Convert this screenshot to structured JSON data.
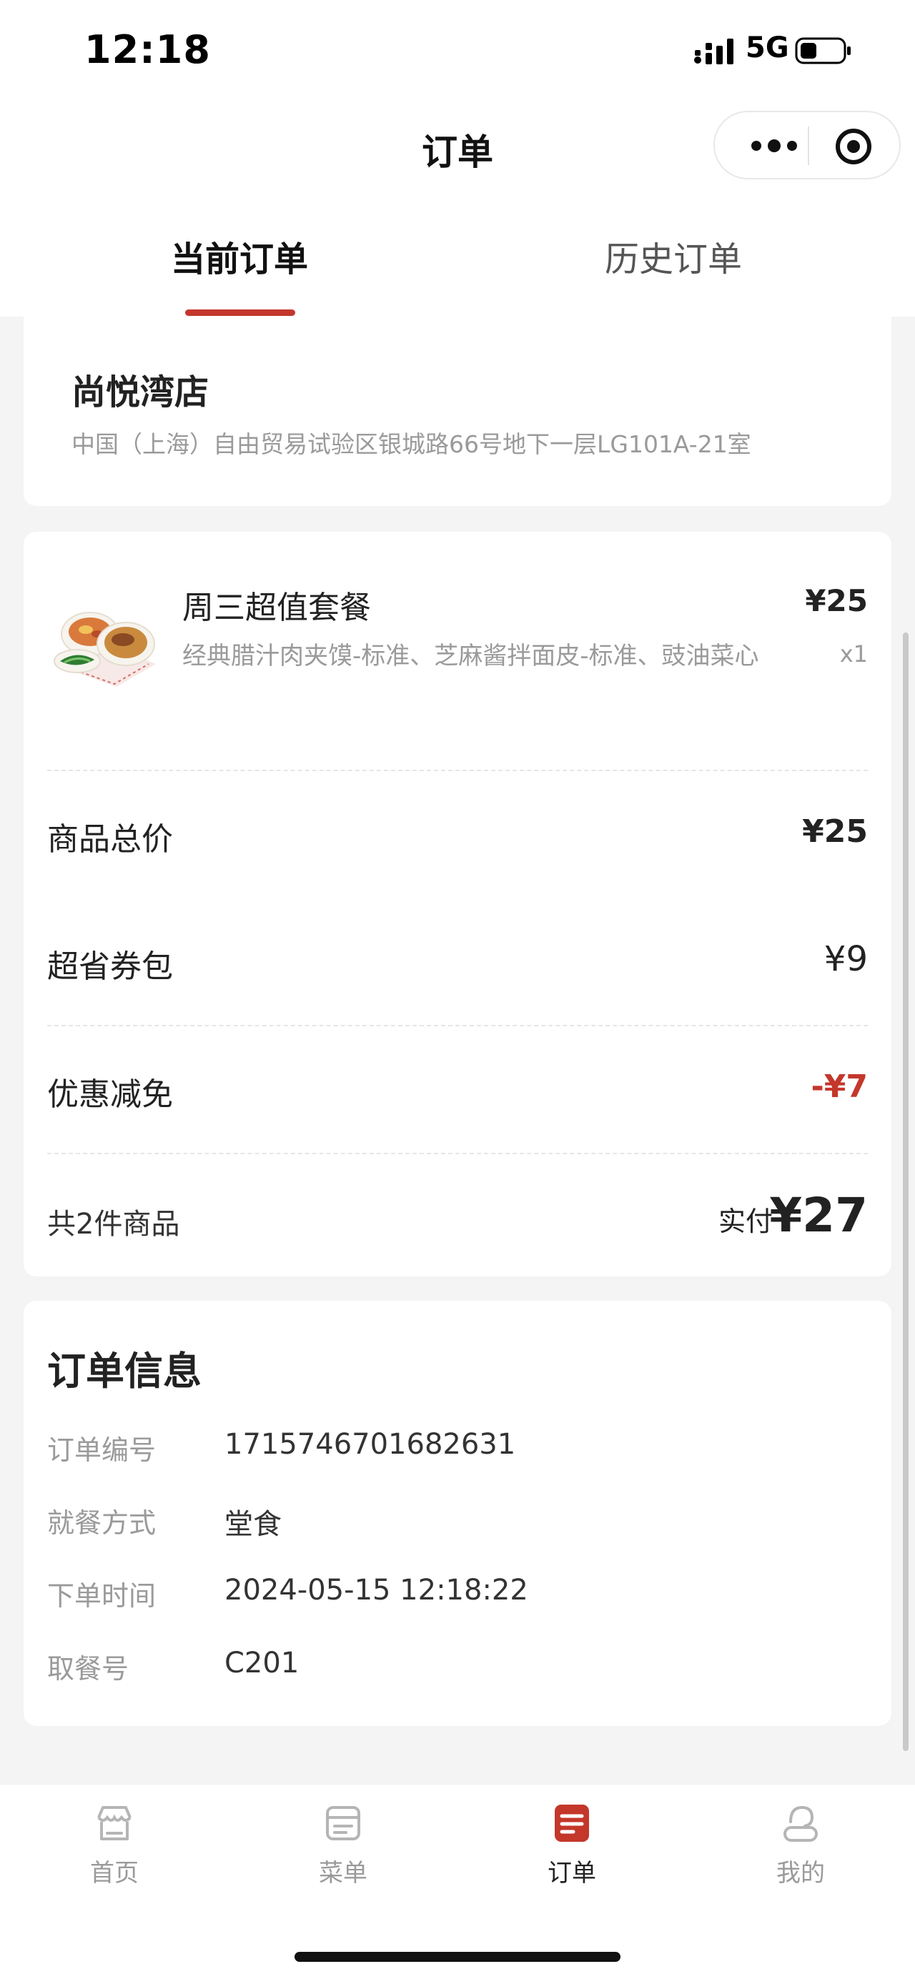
{
  "status_bar": {
    "time": "12:18",
    "network": "5G",
    "signal_icon": "cellular-signal-icon",
    "battery_icon": "battery-icon"
  },
  "nav": {
    "title": "订单",
    "more_icon": "more-dots-icon",
    "target_icon": "target-icon"
  },
  "tabs": [
    {
      "label": "当前订单",
      "active": true
    },
    {
      "label": "历史订单",
      "active": false
    }
  ],
  "store": {
    "name": "尚悦湾店",
    "address": "中国（上海）自由贸易试验区银城路66号地下一层LG101A-21室"
  },
  "order": {
    "items": [
      {
        "name": "周三超值套餐",
        "price": "¥25",
        "description": "经典腊汁肉夹馍-标准、芝麻酱拌面皮-标准、豉油菜心",
        "quantity": "x1"
      }
    ],
    "summary": [
      {
        "label": "商品总价",
        "value": "¥25"
      },
      {
        "label": "超省券包",
        "value": "¥9"
      },
      {
        "label": "优惠减免",
        "value": "-¥7"
      }
    ],
    "total": {
      "count_label": "共2件商品",
      "paid_label": "实付",
      "paid_value": "¥27"
    }
  },
  "info": {
    "title": "订单信息",
    "rows": [
      {
        "label": "订单编号",
        "value": "1715746701682631"
      },
      {
        "label": "就餐方式",
        "value": "堂食"
      },
      {
        "label": "下单时间",
        "value": "2024-05-15 12:18:22"
      },
      {
        "label": "取餐号",
        "value": "C201"
      }
    ]
  },
  "tab_bar": [
    {
      "label": "首页",
      "icon": "store-icon",
      "active": false
    },
    {
      "label": "菜单",
      "icon": "menu-icon",
      "active": false
    },
    {
      "label": "订单",
      "icon": "order-icon",
      "active": true
    },
    {
      "label": "我的",
      "icon": "profile-icon",
      "active": false
    }
  ],
  "colors": {
    "accent": "#c4372b",
    "background": "#f4f4f4",
    "text_muted": "#9a9a9a"
  }
}
